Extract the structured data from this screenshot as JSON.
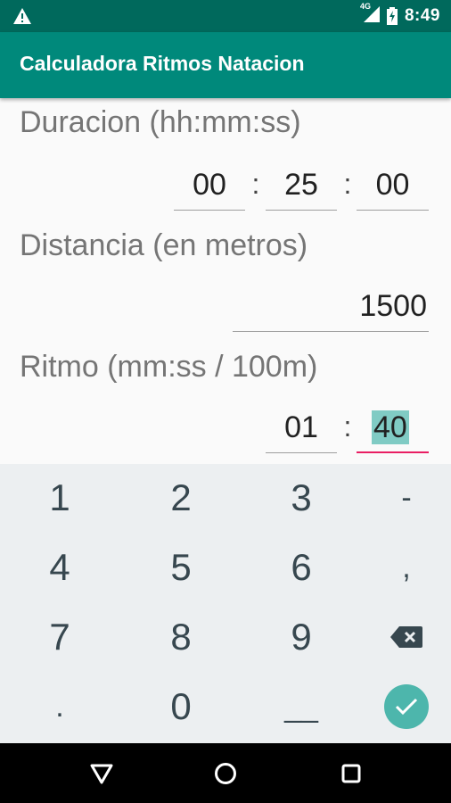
{
  "status_bar": {
    "time": "8:49",
    "network": "4G",
    "icons": [
      "warning-icon",
      "signal-icon",
      "battery-charging-icon"
    ]
  },
  "app_bar": {
    "title": "Calculadora Ritmos Natacion"
  },
  "duracion": {
    "label": "Duracion (hh:mm:ss)",
    "hours": "00",
    "minutes": "25",
    "seconds": "00",
    "separator": ":"
  },
  "distancia": {
    "label": "Distancia (en metros)",
    "value": "1500"
  },
  "ritmo": {
    "label": "Ritmo (mm:ss / 100m)",
    "minutes": "01",
    "seconds": "40",
    "separator": ":"
  },
  "keyboard": {
    "row1": [
      "1",
      "2",
      "3",
      "-"
    ],
    "row2": [
      "4",
      "5",
      "6",
      ","
    ],
    "row3": [
      "7",
      "8",
      "9"
    ],
    "row4": [
      ".",
      "0",
      "__"
    ],
    "icons": [
      "backspace-icon",
      "done-check-icon"
    ]
  },
  "colors": {
    "status_bar": "#00695c",
    "app_bar": "#00897b",
    "focus_underline": "#e91e63",
    "selection": "#80cbc4",
    "done_button": "#4db6ac"
  }
}
